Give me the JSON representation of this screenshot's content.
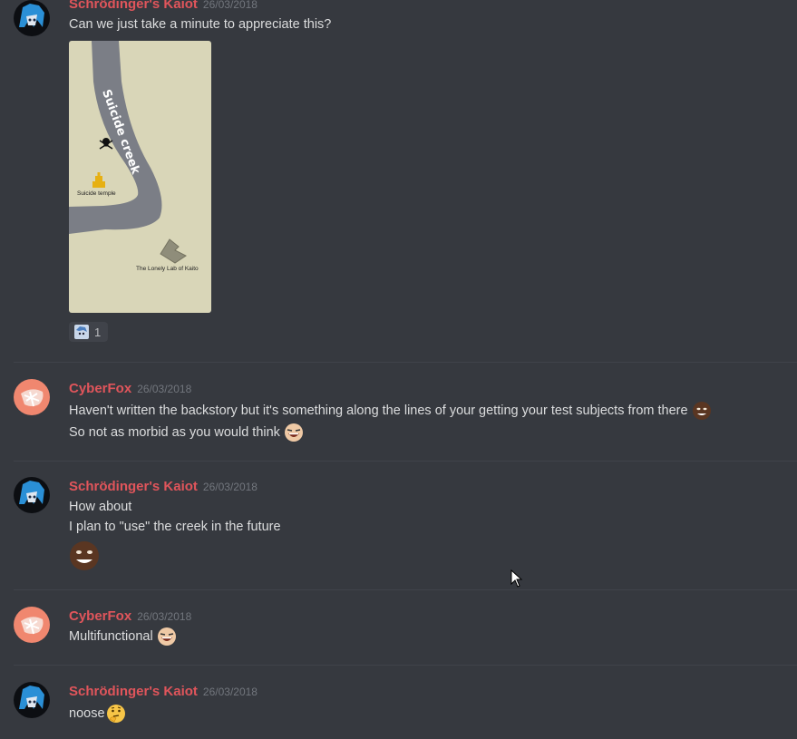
{
  "messages": [
    {
      "username": "Schrödinger's Kaiot",
      "timestamp": "26/03/2018",
      "lines": [
        "Can we just take a minute to appreciate this?"
      ],
      "attachment": {
        "map_labels": {
          "creek": "Suicide creek",
          "temple": "Suicide temple",
          "lab": "The Lonely Lab of Kaito"
        }
      },
      "reaction": {
        "icon": "anime-face-emoji",
        "count": "1"
      }
    },
    {
      "username": "CyberFox",
      "timestamp": "26/03/2018",
      "lines": [
        "Haven't written the backstory but it's something along the lines of your getting your test subjects from there",
        "So not as morbid as you would think"
      ]
    },
    {
      "username": "Schrödinger's Kaiot",
      "timestamp": "26/03/2018",
      "lines": [
        "How about",
        "I plan to \"use\" the creek in the future"
      ]
    },
    {
      "username": "CyberFox",
      "timestamp": "26/03/2018",
      "lines": [
        "Multifunctional"
      ]
    },
    {
      "username": "Schrödinger's Kaiot",
      "timestamp": "26/03/2018",
      "lines": [
        "noose"
      ]
    }
  ],
  "colors": {
    "background": "#36393f",
    "username": "#e0555b",
    "text": "#dcddde",
    "timestamp": "#72767d",
    "map_land": "#d9d6b8",
    "map_water": "#7b7e86"
  }
}
